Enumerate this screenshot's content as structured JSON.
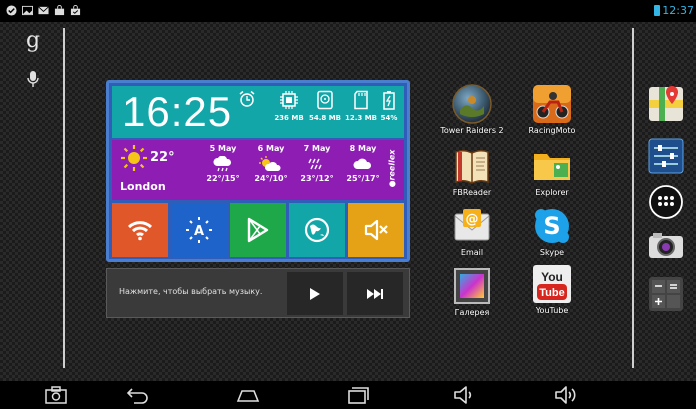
{
  "status_bar": {
    "time": "12:37"
  },
  "widget": {
    "time": "16:25",
    "stats": [
      {
        "label": "236 MB",
        "icon": "cpu-icon"
      },
      {
        "label": "54.8 MB",
        "icon": "storage-icon"
      },
      {
        "label": "12.3 MB",
        "icon": "sdcard-icon"
      },
      {
        "label": "54%",
        "icon": "battery-icon"
      }
    ],
    "weather": {
      "temp": "22°",
      "city": "London",
      "forecast": [
        {
          "day": "5 May",
          "range": "22°/15°",
          "icon": "rain-icon"
        },
        {
          "day": "6 May",
          "range": "24°/10°",
          "icon": "partly-sunny-icon"
        },
        {
          "day": "7 May",
          "range": "23°/12°",
          "icon": "drizzle-icon"
        },
        {
          "day": "8 May",
          "range": "25°/17°",
          "icon": "cloud-icon"
        }
      ],
      "brand": "●reellex"
    }
  },
  "music": {
    "prompt": "Нажмите, чтобы выбрать музыку."
  },
  "apps": [
    {
      "name": "Tower Raiders 2"
    },
    {
      "name": "RacingMoto"
    },
    {
      "name": "FBReader"
    },
    {
      "name": "Explorer"
    },
    {
      "name": "Email"
    },
    {
      "name": "Skype"
    },
    {
      "name": "Галерея"
    },
    {
      "name": "YouTube"
    }
  ],
  "youtube_logo": {
    "top": "You",
    "bottom": "Tube"
  }
}
